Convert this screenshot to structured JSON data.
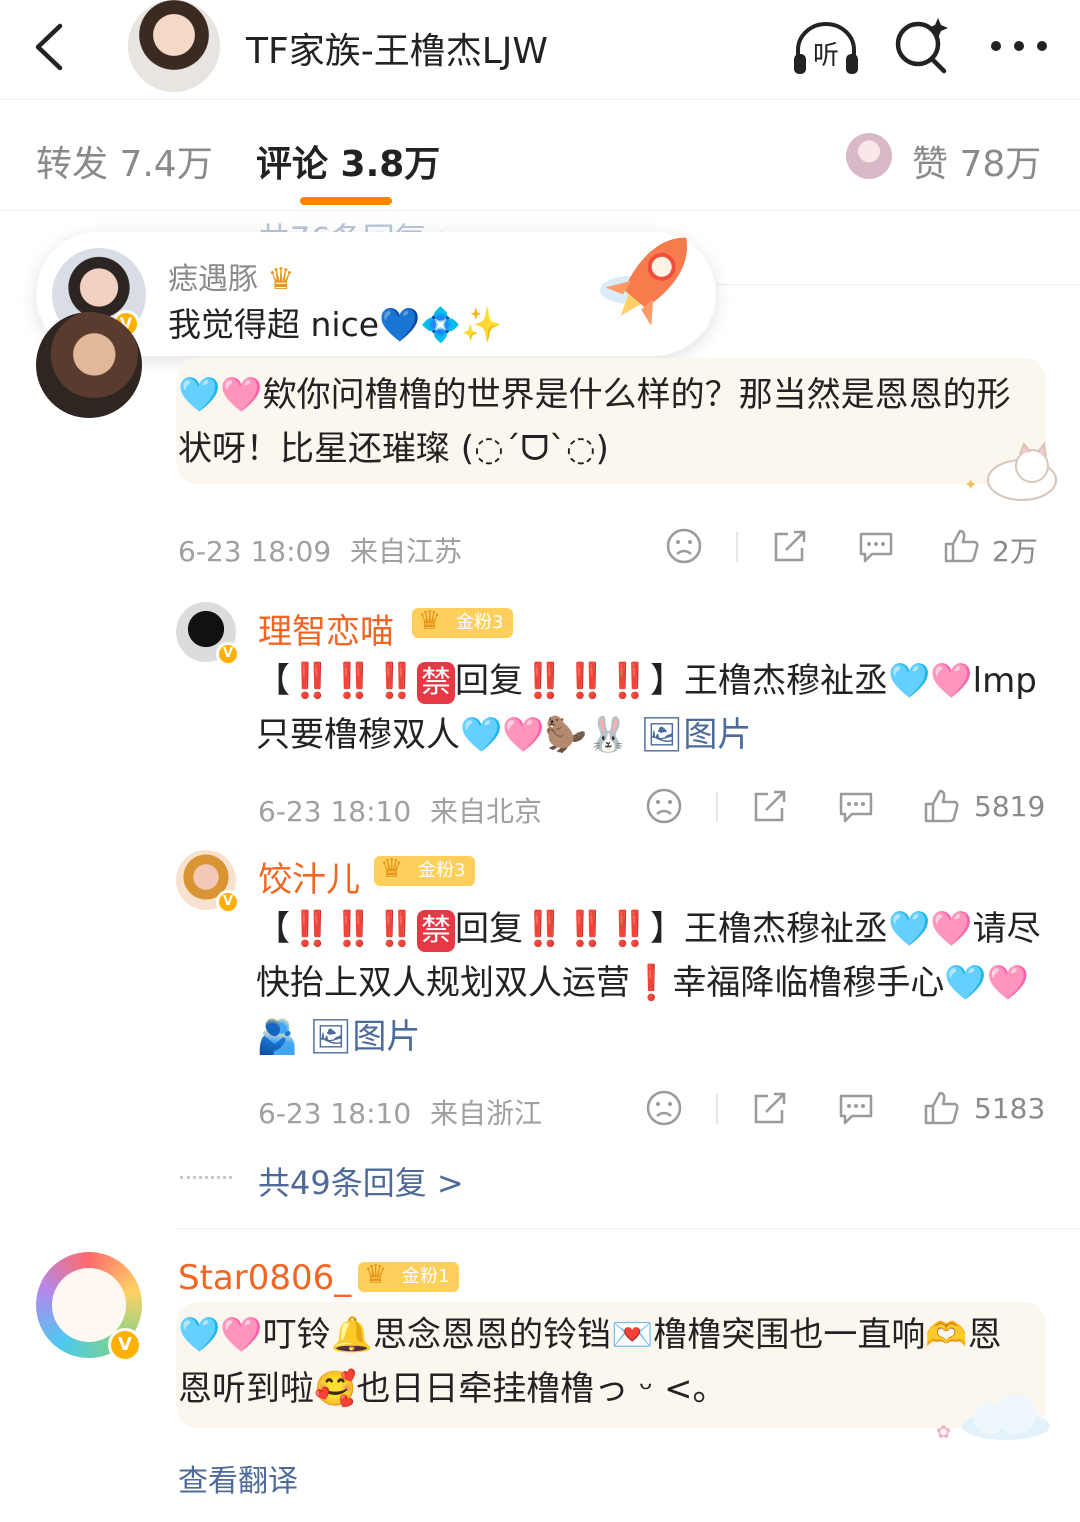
{
  "header": {
    "title": "TF家族-王橹杰LJW",
    "listen_label": "听"
  },
  "tabs": {
    "repost": "转发 7.4万",
    "comment": "评论 3.8万",
    "like": "赞 78万"
  },
  "faded_reply": "共76条回复 >",
  "popup": {
    "name": "痣遇豚",
    "text": "我觉得超 nice💙💠✨"
  },
  "comment1": {
    "text": "🩵🩷欸你问橹橹的世界是什么样的？那当然是恩恩的形状呀！比星还璀璨 (◌´ᗜ`◌)",
    "time": "6-23 18:09",
    "location": "来自江苏",
    "likes": "2万"
  },
  "reply1": {
    "name": "理智恋喵",
    "badge": "金粉3",
    "text_pre": "【‼️‼️‼️",
    "ban": "禁",
    "text_mid": "回复",
    "text_post": "‼️‼️‼️】王橹杰穆祉丞🩵🩷lmp只要橹穆双人🩵🩷🦫🐰",
    "img_link": "🖼图片",
    "time": "6-23 18:10",
    "location": "来自北京",
    "likes": "5819"
  },
  "reply2": {
    "name": "饺汁儿",
    "badge": "金粉3",
    "text_pre": "【‼️‼️‼️",
    "ban": "禁",
    "text_mid": "回复",
    "text_post": "‼️‼️‼️】王橹杰穆祉丞🩵🩷请尽快抬上双人规划双人运营❗幸福降临橹穆手心🩵🩷🫂",
    "img_link": "🖼图片",
    "time": "6-23 18:10",
    "location": "来自浙江",
    "likes": "5183"
  },
  "more_replies": "共49条回复 >",
  "comment2": {
    "name": "Star0806_",
    "badge": "金粉1",
    "text": "🩵🩷叮铃🔔思念恩恩的铃铛💌橹橹突围也一直响🫶恩恩听到啦🥰也日日牵挂橹橹っ ᵕ <。",
    "translate": "查看翻译"
  }
}
